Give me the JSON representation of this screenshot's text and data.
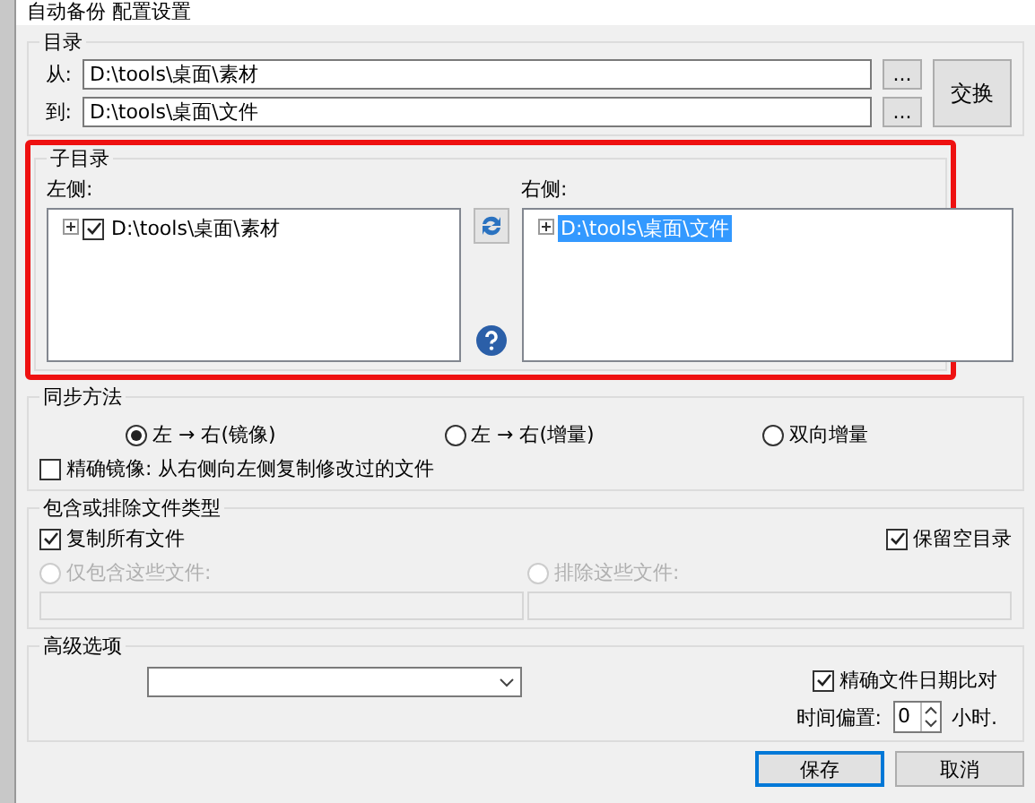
{
  "window": {
    "title": "自动备份 配置设置"
  },
  "directories": {
    "title": "目录",
    "from": {
      "label": "从:",
      "value": "D:\\tools\\桌面\\素材"
    },
    "to": {
      "label": "到:",
      "value": "D:\\tools\\桌面\\文件"
    },
    "browse_buttons": [
      "...",
      "..."
    ],
    "swap_button": "交换"
  },
  "subdirectories": {
    "title": "子目录",
    "highlighted": true,
    "left": {
      "label": "左侧:",
      "items": [
        {
          "text": "D:\\tools\\桌面\\素材",
          "checked": true,
          "selected": false
        }
      ]
    },
    "right": {
      "label": "右侧:",
      "items": [
        {
          "text": "D:\\tools\\桌面\\文件",
          "selected": true
        }
      ]
    }
  },
  "sync_method": {
    "title": "同步方法",
    "options": [
      {
        "label": "左 → 右(镜像)",
        "selected": true
      },
      {
        "label": "左 → 右(增量)",
        "selected": false
      },
      {
        "label": "双向增量",
        "selected": false
      }
    ],
    "exact_mirror": {
      "label": "精确镜像: 从右侧向左侧复制修改过的文件",
      "checked": false
    }
  },
  "file_types": {
    "title": "包含或排除文件类型",
    "copy_all": {
      "label": "复制所有文件",
      "checked": true
    },
    "keep_empty": {
      "label": "保留空目录",
      "checked": true
    },
    "filters": [
      {
        "label": "仅包含这些文件:",
        "selected": false,
        "disabled": true
      },
      {
        "label": "排除这些文件:",
        "selected": false,
        "disabled": true
      }
    ]
  },
  "advanced": {
    "title": "高级选项",
    "exact_date": {
      "label": "精确文件日期比对",
      "checked": true
    },
    "offset": {
      "label": "时间偏置:",
      "value": "0",
      "unit": "小时."
    }
  },
  "buttons": [
    {
      "label": "保存",
      "default": true
    },
    {
      "label": "取消",
      "default": false
    }
  ]
}
